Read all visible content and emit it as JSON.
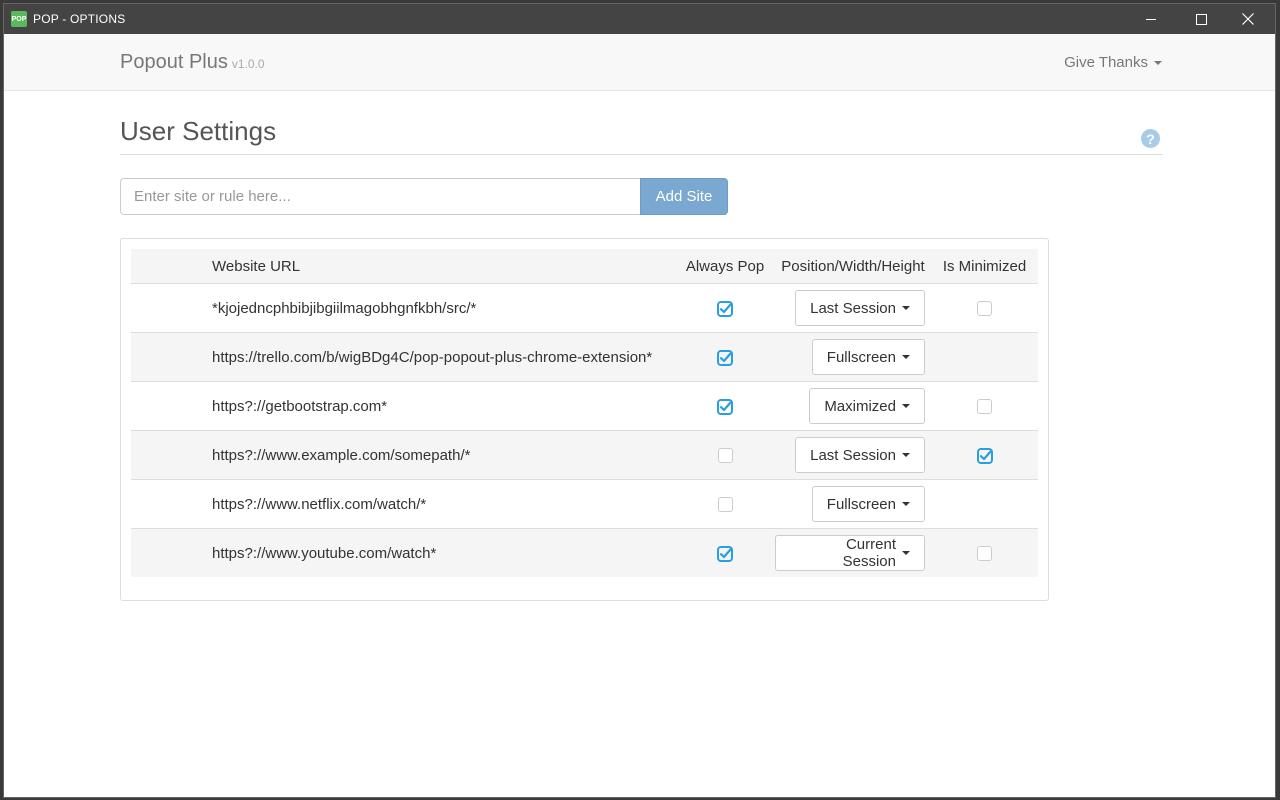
{
  "window": {
    "title": "POP - OPTIONS",
    "app_icon_text": "POP"
  },
  "navbar": {
    "brand": "Popout Plus",
    "version": "v1.0.0",
    "give_thanks": "Give Thanks"
  },
  "header": {
    "title": "User Settings",
    "help_glyph": "?"
  },
  "add_form": {
    "placeholder": "Enter site or rule here...",
    "button_label": "Add Site"
  },
  "table": {
    "columns": [
      "Website URL",
      "Always Pop",
      "Position/Width/Height",
      "Is Minimized"
    ],
    "rows": [
      {
        "url": "*kjojedncphbibjibgiilmagobhgnfkbh/src/*",
        "always_pop": true,
        "position": "Last Session",
        "is_minimized": false
      },
      {
        "url": "https://trello.com/b/wigBDg4C/pop-popout-plus-chrome-extension*",
        "always_pop": true,
        "position": "Fullscreen",
        "is_minimized": null
      },
      {
        "url": "https?://getbootstrap.com*",
        "always_pop": true,
        "position": "Maximized",
        "is_minimized": false
      },
      {
        "url": "https?://www.example.com/somepath/*",
        "always_pop": false,
        "position": "Last Session",
        "is_minimized": true
      },
      {
        "url": "https?://www.netflix.com/watch/*",
        "always_pop": false,
        "position": "Fullscreen",
        "is_minimized": null
      },
      {
        "url": "https?://www.youtube.com/watch*",
        "always_pop": true,
        "position": "Current Session",
        "is_minimized": false
      }
    ]
  },
  "colors": {
    "accent": "#2a9fe0",
    "add_button": "#7aa8d1",
    "titlebar": "#444444"
  }
}
